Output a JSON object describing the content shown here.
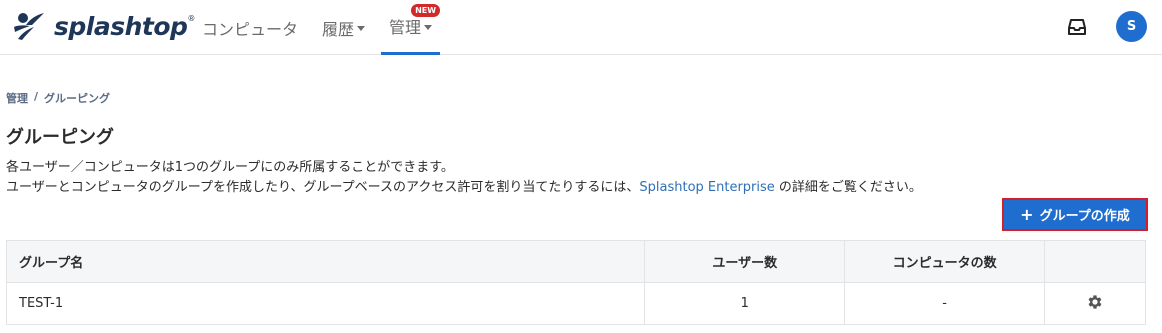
{
  "brand": {
    "name": "splashtop",
    "trademark": "®"
  },
  "nav": {
    "items": [
      {
        "label": "コンピュータ",
        "dropdown": false
      },
      {
        "label": "履歴",
        "dropdown": true
      },
      {
        "label": "管理",
        "dropdown": true,
        "badge": "NEW",
        "active": true
      }
    ]
  },
  "header": {
    "avatar_initial": "S",
    "inbox_icon": "inbox-icon"
  },
  "breadcrumb": {
    "parent": "管理",
    "separator": "/",
    "current": "グルーピング"
  },
  "page": {
    "title": "グルーピング",
    "desc_line1": "各ユーザー／コンピュータは1つのグループにのみ所属することができます。",
    "desc_line2_pre": "ユーザーとコンピュータのグループを作成したり、グループベースのアクセス許可を割り当てたりするには、",
    "desc_link": "Splashtop Enterprise",
    "desc_line2_post": " の詳細をご覧ください。"
  },
  "actions": {
    "create_group": "グループの作成",
    "create_icon": "+"
  },
  "table": {
    "columns": [
      "グループ名",
      "ユーザー数",
      "コンピュータの数",
      ""
    ],
    "rows": [
      {
        "name": "TEST-1",
        "users": "1",
        "computers": "-"
      }
    ]
  },
  "colors": {
    "accent": "#1f6ecf",
    "badge": "#d12a2a",
    "highlight_border": "#d41f2b"
  }
}
